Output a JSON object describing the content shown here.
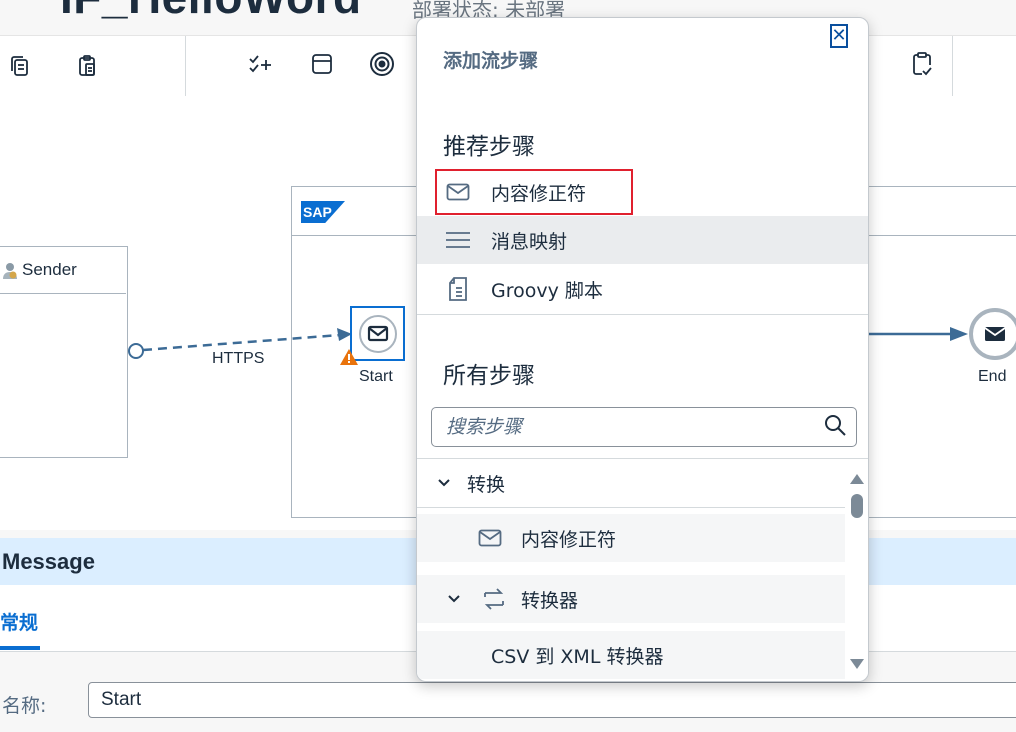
{
  "header": {
    "title": "IF_HelloWord",
    "deploy_status": "部署状态: 未部署"
  },
  "toolbar": {
    "icons": [
      "copy-icon",
      "paste-icon",
      "checklist-add-icon",
      "layout-icon",
      "target-icon",
      "clipboard-check-icon"
    ]
  },
  "diagram": {
    "sender_label": "Sender",
    "connection_label": "HTTPS",
    "start_label": "Start",
    "end_label": "End",
    "logo_text": "SAP"
  },
  "properties": {
    "title": "Message",
    "tab_general": "常规",
    "name_label": "名称:",
    "name_value": "Start"
  },
  "popover": {
    "title": "添加流步骤",
    "close_icon": "close-icon",
    "recommended_heading": "推荐步骤",
    "recommended": [
      {
        "label": "内容修正符",
        "icon": "envelope-icon"
      },
      {
        "label": "消息映射",
        "icon": "lines-icon"
      },
      {
        "label": "Groovy 脚本",
        "icon": "document-icon"
      }
    ],
    "all_heading": "所有步骤",
    "search_placeholder": "搜索步骤",
    "tree": [
      {
        "label": "转换",
        "icon": "chevron-down-icon"
      },
      {
        "label": "内容修正符",
        "icon": "envelope-icon"
      },
      {
        "label": "转换器",
        "icon": "converter-icon"
      },
      {
        "label": "CSV 到 XML 转换器",
        "icon": ""
      }
    ]
  },
  "colors": {
    "accent": "#0a6ed1",
    "highlight": "#e0202e",
    "message_bar": "#dbeeff",
    "warning": "#e9730c"
  }
}
